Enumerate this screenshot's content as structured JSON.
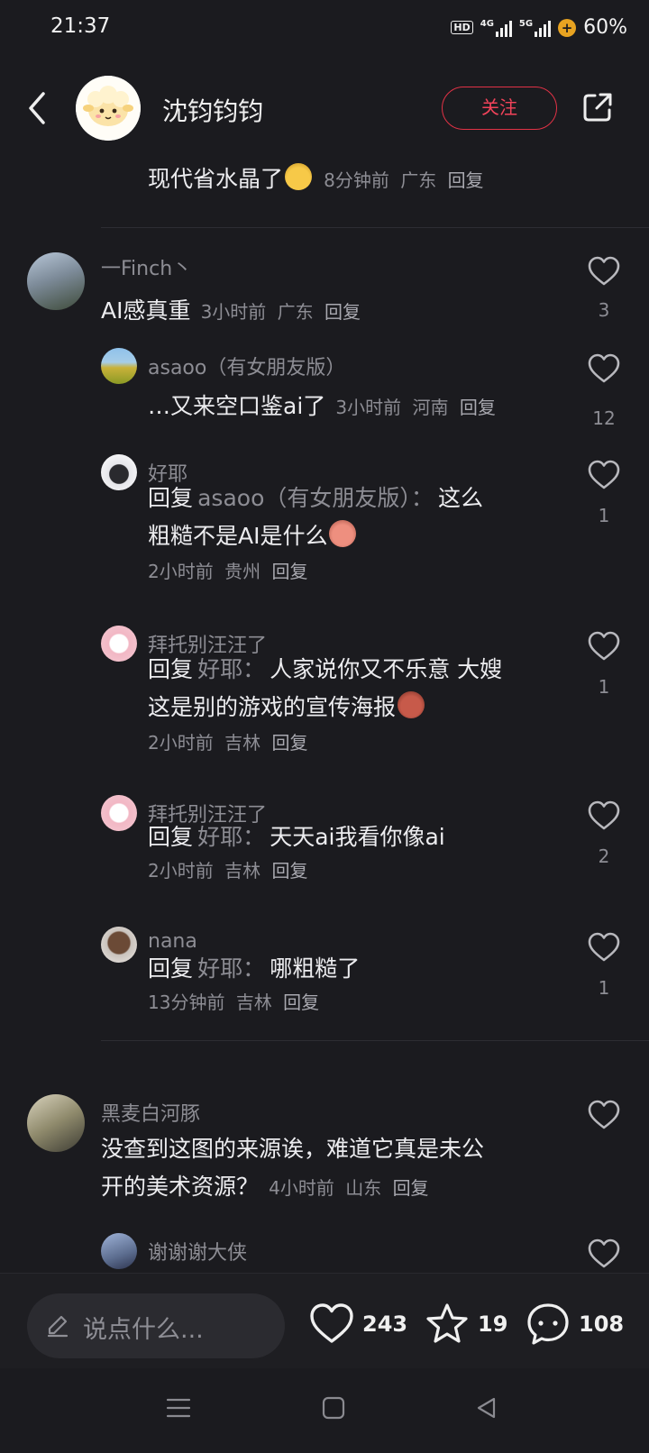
{
  "status_bar": {
    "time": "21:37",
    "hd": "HD",
    "net1": "4G",
    "net2": "5G",
    "battery": "60%"
  },
  "header": {
    "title": "沈钧钧钧",
    "follow_label": "关注"
  },
  "top_partial": {
    "text": "现代省水晶了",
    "time": "8分钟前",
    "location": "广东",
    "reply": "回复"
  },
  "comments": [
    {
      "user": "一Finch丶",
      "text": "AI感真重",
      "time": "3小时前",
      "location": "广东",
      "reply": "回复",
      "likes": "3",
      "replies": [
        {
          "user": "asaoo（有女朋友版）",
          "text": "…又来空口鉴ai了",
          "time": "3小时前",
          "location": "河南",
          "reply": "回复",
          "likes": "12"
        },
        {
          "user": "好耶",
          "reply_prefix": "回复",
          "reply_to": "asaoo（有女朋友版）：",
          "text_line1": "这么",
          "text_line2": "粗糙不是AI是什么",
          "time": "2小时前",
          "location": "贵州",
          "reply": "回复",
          "likes": "1"
        },
        {
          "user": "拜托别汪汪了",
          "reply_prefix": "回复",
          "reply_to": "好耶：",
          "text_line1": "人家说你又不乐意 大嫂",
          "text_line2": "这是别的游戏的宣传海报",
          "time": "2小时前",
          "location": "吉林",
          "reply": "回复",
          "likes": "1"
        },
        {
          "user": "拜托别汪汪了",
          "reply_prefix": "回复",
          "reply_to": "好耶：",
          "text_line1": "天天ai我看你像ai",
          "time": "2小时前",
          "location": "吉林",
          "reply": "回复",
          "likes": "2"
        },
        {
          "user": "nana",
          "reply_prefix": "回复",
          "reply_to": "好耶：",
          "text_line1": "哪粗糙了",
          "time": "13分钟前",
          "location": "吉林",
          "reply": "回复",
          "likes": "1"
        }
      ]
    },
    {
      "user": "黑麦白河豚",
      "text_line1": "没查到这图的来源诶，难道它真是未公",
      "text_line2": "开的美术资源？",
      "time": "4小时前",
      "location": "山东",
      "reply": "回复",
      "replies": [
        {
          "user": "谢谢谢大侠"
        }
      ]
    }
  ],
  "bottom_bar": {
    "placeholder": "说点什么...",
    "likes": "243",
    "stars": "19",
    "comments": "108"
  },
  "icons": {
    "back": "chevron-left-icon",
    "share": "share-icon",
    "like": "heart-icon",
    "star": "star-icon",
    "comment": "comment-icon",
    "pen": "pen-icon"
  },
  "colors": {
    "background": "#1b1b1f",
    "accent": "#f2435a",
    "muted_text": "#8d8d94"
  }
}
